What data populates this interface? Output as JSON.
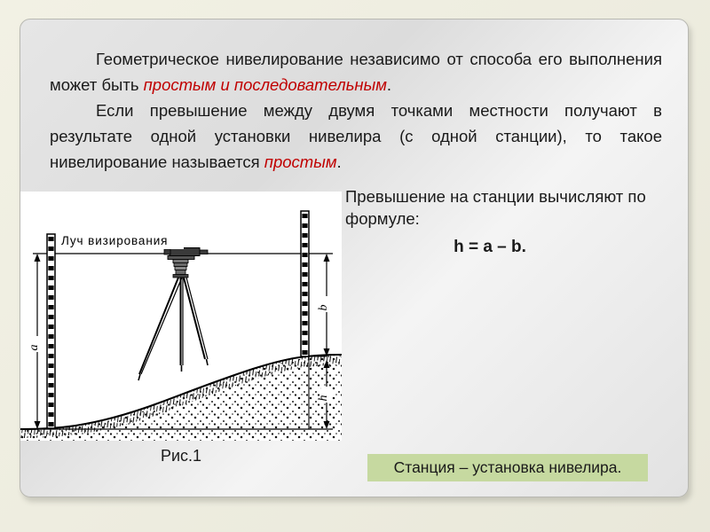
{
  "slide": {
    "title": "Геометрическое нивелирование"
  },
  "prose": {
    "paragraph1": {
      "before": "Геометрическое нивелирование независимо от способа его выполнения может быть ",
      "emphasis": "простым и последовательным",
      "after": "."
    },
    "paragraph2": {
      "before": "Если превышение между двумя точками местности получают в результате одной установки нивелира (с одной станции), то такое нивелирование называется ",
      "emphasis": "простым",
      "after": "."
    }
  },
  "figure": {
    "caption": "Рис.1",
    "sight_line_label": "Луч визирования",
    "dimension_a": "a",
    "dimension_b": "b",
    "dimension_h": "h"
  },
  "formula": {
    "intro": "Превышение на станции вычисляют по формуле:",
    "expression": "h = a – b."
  },
  "callout": {
    "text": "Станция – установка нивелира."
  },
  "colors": {
    "emphasis_red": "#C00000",
    "callout_green": "#C6D9A0",
    "slide_background": "#EDEDE0",
    "panel_background": "#E4E4E4",
    "text": "#1A1A1A"
  }
}
